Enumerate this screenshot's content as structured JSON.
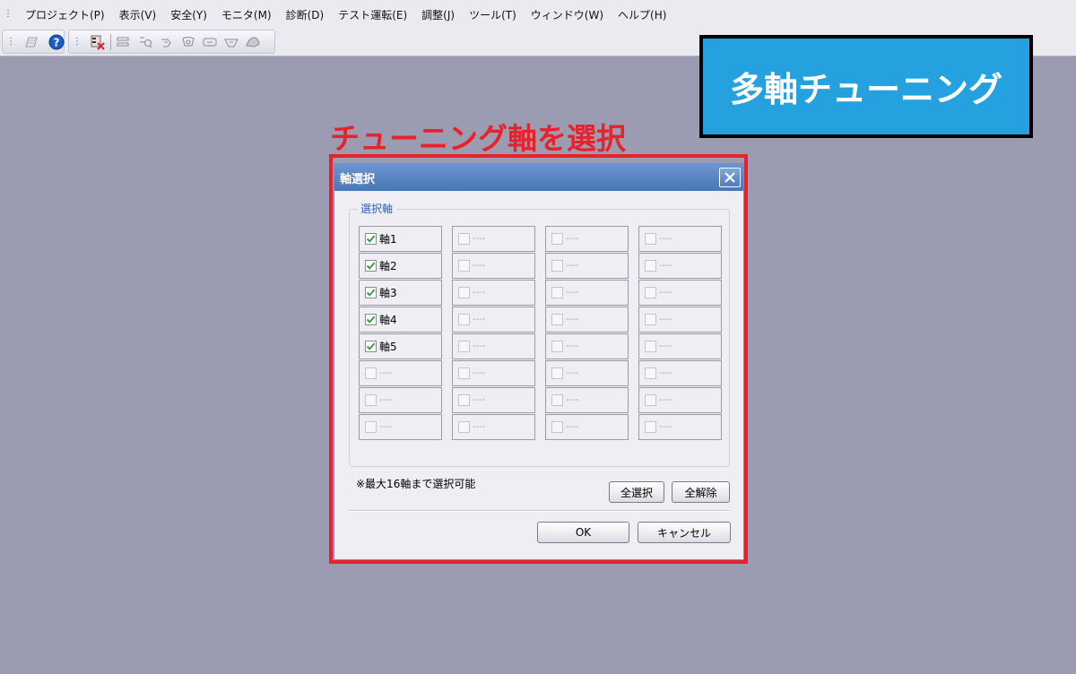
{
  "menubar": {
    "items": [
      "プロジェクト(P)",
      "表示(V)",
      "安全(Y)",
      "モニタ(M)",
      "診断(D)",
      "テスト運転(E)",
      "調整(J)",
      "ツール(T)",
      "ウィンドウ(W)",
      "ヘルプ(H)"
    ]
  },
  "toolbar": {
    "icons": [
      "parameter-icon",
      "help-icon",
      "axis-setting-icon",
      "tool-1-icon",
      "tool-2-icon",
      "tool-3-icon",
      "tool-4-icon",
      "tool-5-icon",
      "tool-6-icon",
      "tool-7-icon"
    ]
  },
  "banner": {
    "title": "多軸チューニング"
  },
  "callout": {
    "label": "チューニング軸を選択",
    "color": "#e8222b"
  },
  "dialog": {
    "title": "軸選択",
    "group_label": "選択軸",
    "columns": [
      [
        {
          "label": "軸1",
          "checked": true
        },
        {
          "label": "軸2",
          "checked": true
        },
        {
          "label": "軸3",
          "checked": true
        },
        {
          "label": "軸4",
          "checked": true
        },
        {
          "label": "軸5",
          "checked": true
        },
        {
          "label": "----",
          "checked": false
        },
        {
          "label": "----",
          "checked": false
        },
        {
          "label": "----",
          "checked": false
        }
      ],
      [
        {
          "label": "----",
          "checked": false
        },
        {
          "label": "----",
          "checked": false
        },
        {
          "label": "----",
          "checked": false
        },
        {
          "label": "----",
          "checked": false
        },
        {
          "label": "----",
          "checked": false
        },
        {
          "label": "----",
          "checked": false
        },
        {
          "label": "----",
          "checked": false
        },
        {
          "label": "----",
          "checked": false
        }
      ],
      [
        {
          "label": "----",
          "checked": false
        },
        {
          "label": "----",
          "checked": false
        },
        {
          "label": "----",
          "checked": false
        },
        {
          "label": "----",
          "checked": false
        },
        {
          "label": "----",
          "checked": false
        },
        {
          "label": "----",
          "checked": false
        },
        {
          "label": "----",
          "checked": false
        },
        {
          "label": "----",
          "checked": false
        }
      ],
      [
        {
          "label": "----",
          "checked": false
        },
        {
          "label": "----",
          "checked": false
        },
        {
          "label": "----",
          "checked": false
        },
        {
          "label": "----",
          "checked": false
        },
        {
          "label": "----",
          "checked": false
        },
        {
          "label": "----",
          "checked": false
        },
        {
          "label": "----",
          "checked": false
        },
        {
          "label": "----",
          "checked": false
        }
      ]
    ],
    "note": "※最大16軸まで選択可能",
    "select_all_label": "全選択",
    "deselect_all_label": "全解除",
    "ok_label": "OK",
    "cancel_label": "キャンセル"
  },
  "colors": {
    "background": "#9b9cb2",
    "banner": "#25a1df",
    "checkmark": "#2a9a2a",
    "titlebar": "#4a76b8"
  }
}
